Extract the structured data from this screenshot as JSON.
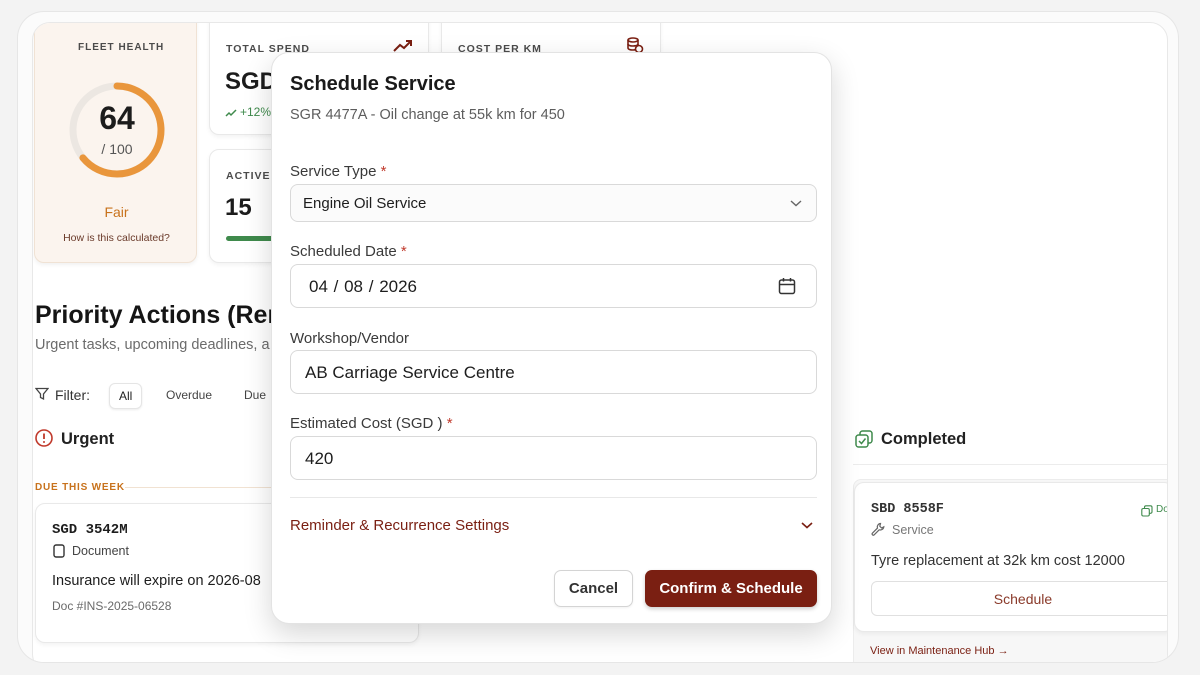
{
  "fleet_health": {
    "label": "FLEET HEALTH",
    "score": "64",
    "max": "/ 100",
    "score_fraction": 0.64,
    "rating": "Fair",
    "calc_link": "How is this calculated?"
  },
  "total_spend": {
    "label": "TOTAL SPEND",
    "value": "SGD",
    "trend": "+12%"
  },
  "cost_per_km": {
    "label": "COST PER KM"
  },
  "active": {
    "label": "ACTIVE",
    "value": "15"
  },
  "priority": {
    "title": "Priority Actions (Rem",
    "subtitle": "Urgent tasks, upcoming deadlines, a"
  },
  "filter": {
    "label": "Filter:",
    "options": [
      "All",
      "Overdue",
      "Due "
    ]
  },
  "urgent": {
    "title": "Urgent",
    "group": "DUE THIS WEEK",
    "card": {
      "plate": "SGD 3542M",
      "type": "Document",
      "desc": "Insurance will expire on 2026-08",
      "doc": "Doc #INS-2025-06528"
    }
  },
  "completed": {
    "title": "Completed",
    "card": {
      "plate": "SBD 8558F",
      "type": "Service",
      "tag": "Do",
      "desc": "Tyre replacement at 32k km cost 12000",
      "button": "Schedule"
    },
    "link": "View in Maintenance Hub →"
  },
  "modal": {
    "title": "Schedule Service",
    "subtitle": "SGR 4477A - Oil change at 55k km for 450",
    "service_type_label": "Service Type",
    "service_type_value": "Engine Oil Service",
    "date_label": "Scheduled Date",
    "date": {
      "d": "04",
      "m": "08",
      "y": "2026"
    },
    "vendor_label": "Workshop/Vendor",
    "vendor_value": "AB Carriage Service Centre",
    "cost_label": "Estimated Cost (SGD )",
    "cost_value": "420",
    "reminder_label": "Reminder & Recurrence Settings",
    "cancel": "Cancel",
    "confirm": "Confirm & Schedule",
    "required_mark": "*"
  },
  "colors": {
    "brand": "#7a1f12",
    "gauge": "#e9963c",
    "success": "#3f8a4c",
    "urgent": "#c0392b",
    "accent_orange": "#c8721c"
  }
}
